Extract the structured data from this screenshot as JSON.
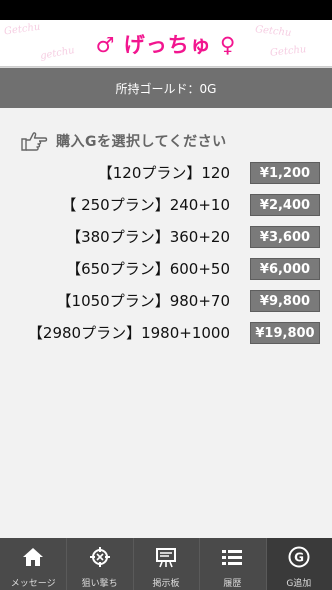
{
  "header": {
    "logo_text": "♂ げっちゅ ♀",
    "bg_scribbles": [
      "Getchu",
      "getchu",
      "Getchu",
      "Getchu"
    ]
  },
  "gold_bar": {
    "text": "所持ゴールド：0G"
  },
  "prompt": {
    "text": "購入Gを選択してください",
    "icon": "pointing-hand-icon"
  },
  "plans": [
    {
      "label": "【120プラン】120",
      "price": "¥1,200"
    },
    {
      "label": "【 250プラン】240+10",
      "price": "¥2,400"
    },
    {
      "label": "【380プラン】360+20",
      "price": "¥3,600"
    },
    {
      "label": "【650プラン】600+50",
      "price": "¥6,000"
    },
    {
      "label": "【1050プラン】980+70",
      "price": "¥9,800"
    },
    {
      "label": "【2980プラン】1980+1000",
      "price": "¥19,800"
    }
  ],
  "tabs": [
    {
      "label": "メッセージ",
      "icon": "home-icon"
    },
    {
      "label": "狙い撃ち",
      "icon": "target-icon"
    },
    {
      "label": "掲示板",
      "icon": "board-icon"
    },
    {
      "label": "履歴",
      "icon": "list-icon"
    },
    {
      "label": "G追加",
      "icon": "g-coin-icon"
    }
  ],
  "colors": {
    "brand_pink": "#f2158f",
    "gold_bar_bg": "#707070",
    "price_button_bg": "#7a7a7a",
    "tab_bar_bg": "#4a4a4a"
  }
}
